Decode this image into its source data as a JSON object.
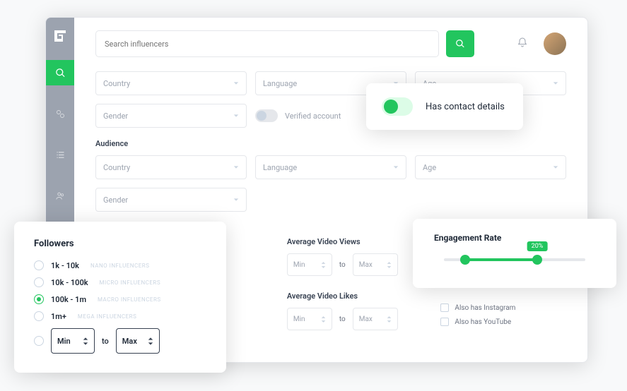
{
  "search": {
    "placeholder": "Search influencers"
  },
  "filters": {
    "country": "Country",
    "language": "Language",
    "age": "Age",
    "gender": "Gender",
    "verified_label": "Verified account"
  },
  "audience": {
    "title": "Audience",
    "country": "Country",
    "language": "Language",
    "age": "Age",
    "gender": "Gender"
  },
  "followers": {
    "title": "Followers",
    "options": [
      {
        "label": "1k - 10k",
        "sub": "NANO INFLUENCERS"
      },
      {
        "label": "10k - 100k",
        "sub": "MICRO INFLUENCERS"
      },
      {
        "label": "100k - 1m",
        "sub": "MACRO INFLUENCERS"
      },
      {
        "label": "1m+",
        "sub": "MEGA INFLUENCERS"
      }
    ],
    "min": "Min",
    "max": "Max",
    "to": "to"
  },
  "metrics": {
    "avg_views": "Average Video Views",
    "avg_likes": "Average Video Likes",
    "min": "Min",
    "max": "Max",
    "to": "to"
  },
  "also": {
    "instagram": "Also has Instagram",
    "youtube": "Also has YouTube"
  },
  "contact": {
    "label": "Has contact details"
  },
  "engagement": {
    "title": "Engagement Rate",
    "value_text": "20%",
    "start_pct": 15,
    "end_pct": 66
  }
}
